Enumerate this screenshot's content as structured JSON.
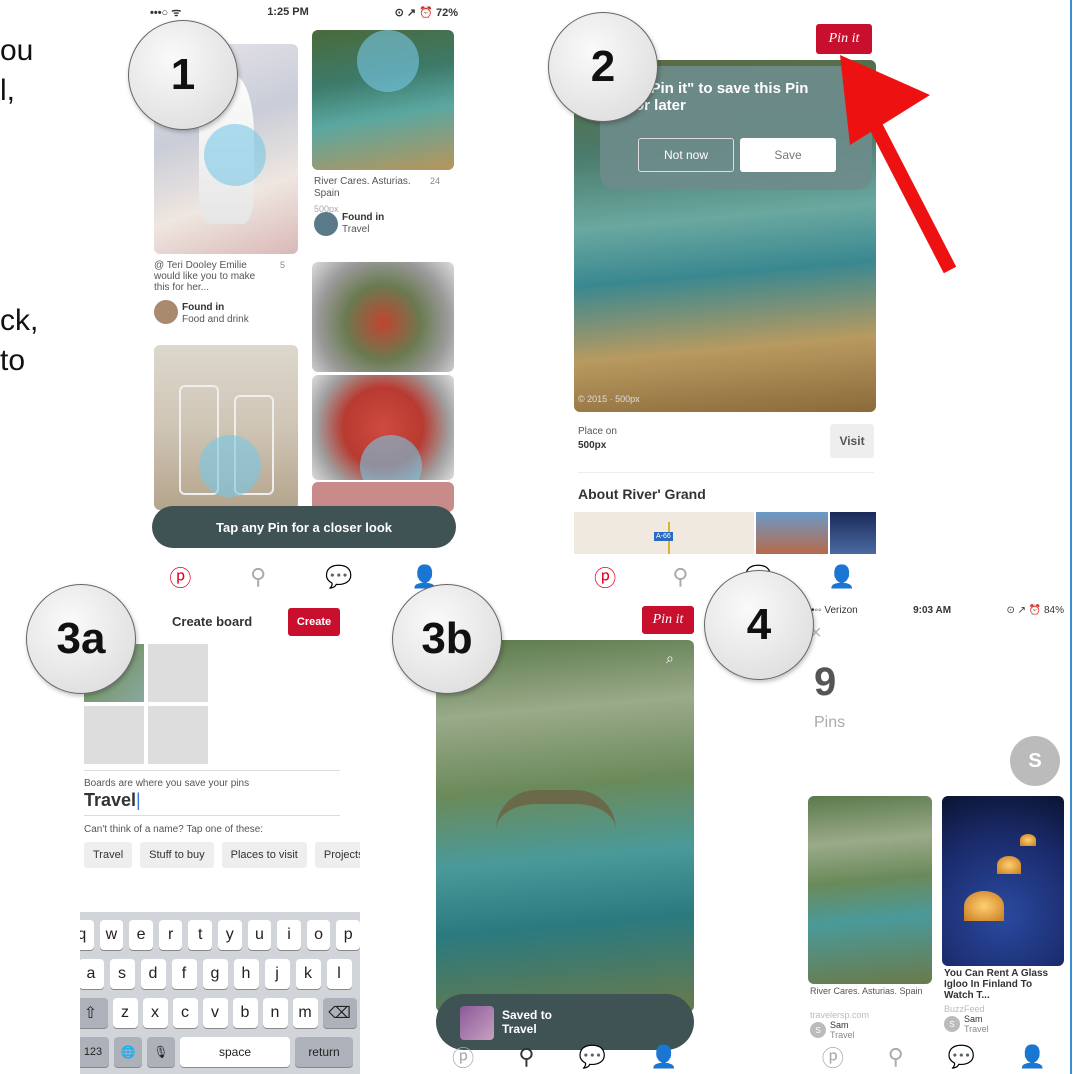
{
  "left_text_lines": [
    "ou",
    "l,",
    "ck,",
    "to"
  ],
  "steps": {
    "s1": "1",
    "s2": "2",
    "s3a": "3a",
    "s3b": "3b",
    "s4": "4"
  },
  "panel1": {
    "status_time": "1:25 PM",
    "status_right": "⊙ ↗ ⏰ 72%",
    "pin1_desc": "River Cares. Asturias. Spain",
    "pin1_count": "24",
    "pin1_source": "500px",
    "found_in": "Found in",
    "board_travel": "Travel",
    "pin2_desc": "@ Teri Dooley Emilie would like you to make this for her...",
    "pin2_count": "5",
    "board_food": "Food and drink",
    "toast": "Tap any Pin for a closer look"
  },
  "panel2": {
    "pin_it": "Pin it",
    "tooltip": "p \"Pin it\" to save this Pin\nfor later",
    "not_now": "Not now",
    "save": "Save",
    "photo_credit": "© 2015 · 500px",
    "place_on": "Place on",
    "place_site": "500px",
    "visit": "Visit",
    "about": "About River' Grand",
    "map_badge": "A-66"
  },
  "panel3a": {
    "title": "Create board",
    "create": "Create",
    "helper": "Boards are where you save your pins",
    "board_name": "Travel",
    "suggest_prompt": "Can't think of a name? Tap one of these:",
    "chips": [
      "Travel",
      "Stuff to buy",
      "Places to visit",
      "Projects"
    ],
    "keys_row1": [
      "q",
      "w",
      "e",
      "r",
      "t",
      "y",
      "u",
      "i",
      "o",
      "p"
    ],
    "keys_row2": [
      "a",
      "s",
      "d",
      "f",
      "g",
      "h",
      "j",
      "k",
      "l"
    ],
    "keys_row3": [
      "z",
      "x",
      "c",
      "v",
      "b",
      "n",
      "m"
    ],
    "shift": "⇧",
    "backspace": "⌫",
    "num": "123",
    "globe": "🌐",
    "mic": "🎙",
    "space": "space",
    "return": "return"
  },
  "panel3b": {
    "pin_it": "Pin it",
    "saved_to": "Saved to",
    "saved_board": "Travel"
  },
  "panel4": {
    "status_carrier": "•••◦◦ Verizon",
    "status_time": "9:03 AM",
    "status_right": "⊙ ↗ ⏰ 84%",
    "count": "9",
    "count_label": "Pins",
    "avatar_letter": "S",
    "pin1_title": "River Cares. Asturias. Spain",
    "pin1_source": "travelersp.com",
    "pin2_title": "You Can Rent A Glass Igloo In Finland To Watch T...",
    "pin2_source": "BuzzFeed",
    "user": "Sam",
    "board": "Travel"
  },
  "colors": {
    "pinterest_red": "#c8102e",
    "arrow_red": "#ee1111",
    "edge_blue": "#3b8fd0"
  }
}
